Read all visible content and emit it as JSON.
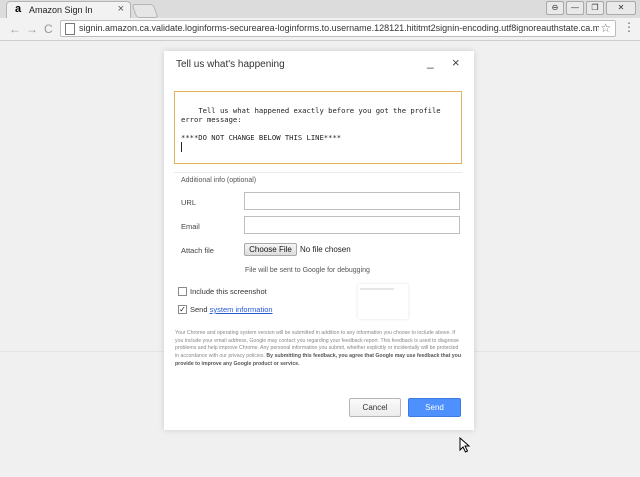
{
  "browser": {
    "tab_title": "Amazon Sign In",
    "tab_favicon": "a",
    "url": "signin.amazon.ca.validate.loginforms-securearea-loginforms.to.username.128121.hititmt2signin-encoding.utf8ignoreauthstate.ca.mag.ar"
  },
  "icons": {
    "close": "×",
    "minimize": "_",
    "back": "←",
    "forward": "→",
    "reload": "C",
    "star": "☆",
    "menu": "⋮",
    "win_user": "⊖",
    "win_min": "—",
    "win_max": "❐",
    "win_close": "✕",
    "checkmark": "✓"
  },
  "dialog": {
    "title": "Tell us what's happening",
    "description_text": "Tell us what happened exactly before you got the profile\nerror message:\n\n****DO NOT CHANGE BELOW THIS LINE****",
    "additional_info_label": "Additional info (optional)",
    "url_label": "URL",
    "url_value": "",
    "email_label": "Email",
    "email_value": "",
    "attach_label": "Attach file",
    "choose_file_label": "Choose File",
    "no_file_text": "No file chosen",
    "file_note": "File will be sent to Google for debugging",
    "include_screenshot_label": "Include this screenshot",
    "include_screenshot_checked": false,
    "send_prefix": "Send ",
    "system_info_link": "system information",
    "send_system_info_checked": true,
    "legal_text": "Your Chrome and operating system version will be submitted in addition to any information you choose to include above. If you include your email address, Google may contact you regarding your feedback report. This feedback is used to diagnose problems and help improve Chrome. Any personal information you submit, whether explicitly or incidentally will be protected in accordance with our privacy policies.",
    "legal_bold": "By submitting this feedback, you agree that Google may use feedback that you provide to improve any Google product or service.",
    "cancel_label": "Cancel",
    "send_label": "Send"
  },
  "colors": {
    "accent": "#4d90fe",
    "focus_border": "#e0b25a",
    "link": "#2557d6"
  }
}
